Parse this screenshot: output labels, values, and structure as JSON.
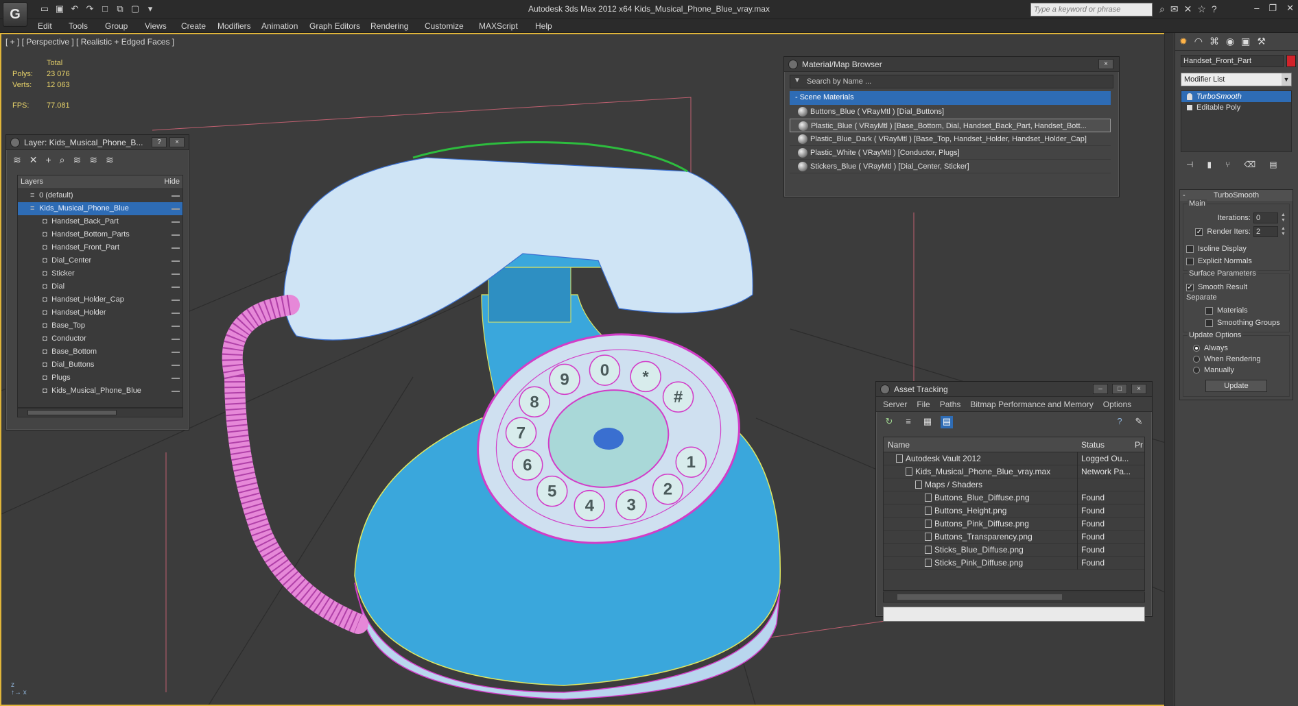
{
  "app": {
    "logo": "G",
    "title": "Autodesk 3ds Max  2012 x64      Kids_Musical_Phone_Blue_vray.max",
    "search_placeholder": "Type a keyword or phrase"
  },
  "menu": [
    "Edit",
    "Tools",
    "Group",
    "Views",
    "Create",
    "Modifiers",
    "Animation",
    "Graph Editors",
    "Rendering",
    "Customize",
    "MAXScript",
    "Help"
  ],
  "viewport": {
    "label": "[ + ] [ Perspective ] [ Realistic + Edged Faces ]",
    "stats": {
      "total_label": "Total",
      "polys_label": "Polys:",
      "polys": "23 076",
      "verts_label": "Verts:",
      "verts": "12 063",
      "fps_label": "FPS:",
      "fps": "77.081"
    },
    "dial_digits": [
      "1",
      "2",
      "3",
      "4",
      "5",
      "6",
      "7",
      "8",
      "9",
      "0",
      "*",
      "#"
    ]
  },
  "layer_explorer": {
    "title": "Layer: Kids_Musical_Phone_B...",
    "help_btn": "?",
    "close_btn": "×",
    "col_layers": "Layers",
    "col_hide": "Hide",
    "rows": [
      {
        "name": "0 (default)",
        "indent": 0
      },
      {
        "name": "Kids_Musical_Phone_Blue",
        "indent": 0,
        "selected": true
      },
      {
        "name": "Handset_Back_Part",
        "indent": 1
      },
      {
        "name": "Handset_Bottom_Parts",
        "indent": 1
      },
      {
        "name": "Handset_Front_Part",
        "indent": 1
      },
      {
        "name": "Dial_Center",
        "indent": 1
      },
      {
        "name": "Sticker",
        "indent": 1
      },
      {
        "name": "Dial",
        "indent": 1
      },
      {
        "name": "Handset_Holder_Cap",
        "indent": 1
      },
      {
        "name": "Handset_Holder",
        "indent": 1
      },
      {
        "name": "Base_Top",
        "indent": 1
      },
      {
        "name": "Conductor",
        "indent": 1
      },
      {
        "name": "Base_Bottom",
        "indent": 1
      },
      {
        "name": "Dial_Buttons",
        "indent": 1
      },
      {
        "name": "Plugs",
        "indent": 1
      },
      {
        "name": "Kids_Musical_Phone_Blue",
        "indent": 1
      }
    ]
  },
  "material_browser": {
    "title": "Material/Map Browser",
    "search": "Search by Name ...",
    "section": "- Scene Materials",
    "rows": [
      "Buttons_Blue  ( VRayMtl ) [Dial_Buttons]",
      "Plastic_Blue  ( VRayMtl ) [Base_Bottom, Dial, Handset_Back_Part, Handset_Bott...",
      "Plastic_Blue_Dark  ( VRayMtl ) [Base_Top, Handset_Holder, Handset_Holder_Cap]",
      "Plastic_White  ( VRayMtl ) [Conductor, Plugs]",
      "Stickers_Blue  ( VRayMtl ) [Dial_Center, Sticker]"
    ],
    "selected_index": 1
  },
  "asset_tracking": {
    "title": "Asset Tracking",
    "menu": [
      "Server",
      "File",
      "Paths",
      "Bitmap Performance and Memory",
      "Options"
    ],
    "col_name": "Name",
    "col_status": "Status",
    "col_extra": "Pr",
    "rows": [
      {
        "name": "Autodesk Vault 2012",
        "status": "Logged Ou...",
        "indent": 0
      },
      {
        "name": "Kids_Musical_Phone_Blue_vray.max",
        "status": "Network Pa...",
        "indent": 1
      },
      {
        "name": "Maps / Shaders",
        "status": "",
        "indent": 2
      },
      {
        "name": "Buttons_Blue_Diffuse.png",
        "status": "Found",
        "indent": 3
      },
      {
        "name": "Buttons_Height.png",
        "status": "Found",
        "indent": 3
      },
      {
        "name": "Buttons_Pink_Diffuse.png",
        "status": "Found",
        "indent": 3
      },
      {
        "name": "Buttons_Transparency.png",
        "status": "Found",
        "indent": 3
      },
      {
        "name": "Sticks_Blue_Diffuse.png",
        "status": "Found",
        "indent": 3
      },
      {
        "name": "Sticks_Pink_Diffuse.png",
        "status": "Found",
        "indent": 3
      }
    ]
  },
  "command_panel": {
    "object_name": "Handset_Front_Part",
    "modifier_list": "Modifier List",
    "stack": [
      "TurboSmooth",
      "Editable Poly"
    ],
    "rollout_title": "TurboSmooth",
    "main_label": "Main",
    "iterations_label": "Iterations:",
    "iterations": "0",
    "render_iters_label": "Render Iters:",
    "render_iters": "2",
    "render_iters_checked": true,
    "isoline": "Isoline Display",
    "explicit_normals": "Explicit Normals",
    "surface_params": "Surface Parameters",
    "smooth_result": "Smooth Result",
    "separate": "Separate",
    "materials": "Materials",
    "smoothing_groups": "Smoothing Groups",
    "update_options": "Update Options",
    "always": "Always",
    "when_rendering": "When Rendering",
    "manually": "Manually",
    "update_btn": "Update"
  },
  "colors": {
    "selection": "#2e6cb5",
    "viewport_border": "#e0b53a",
    "phone_blue": "#3aa7dc",
    "wire_pink": "#d23cc8"
  }
}
